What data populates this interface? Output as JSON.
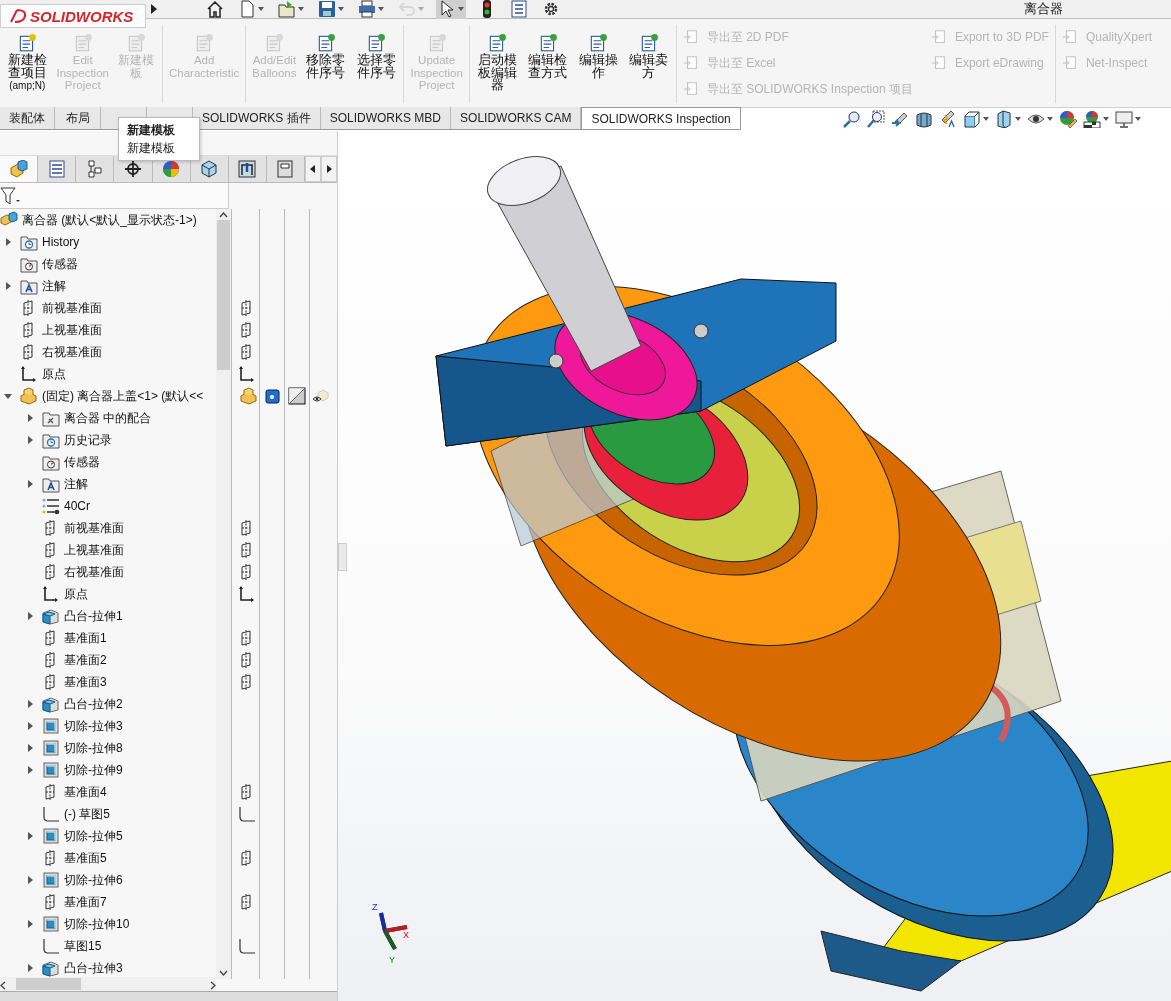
{
  "title_bar": {
    "logo": "SOLIDWORKS",
    "title": "离合器"
  },
  "quick_toolbar": [
    {
      "kind": "home",
      "disabled": false,
      "pressed": false
    },
    {
      "kind": "new",
      "disabled": false,
      "pressed": false
    },
    {
      "kind": "open",
      "disabled": false,
      "pressed": false
    },
    {
      "kind": "save",
      "disabled": false,
      "pressed": false
    },
    {
      "kind": "print",
      "disabled": false,
      "pressed": false
    },
    {
      "kind": "undo",
      "disabled": true,
      "pressed": false
    },
    {
      "kind": "select",
      "disabled": false,
      "pressed": true
    },
    {
      "kind": "rebuild",
      "disabled": false,
      "pressed": false
    },
    {
      "kind": "options-list",
      "disabled": false,
      "pressed": false
    },
    {
      "kind": "settings",
      "disabled": false,
      "pressed": false
    }
  ],
  "ribbon": {
    "groups": [
      {
        "buttons": [
          {
            "kind": "large",
            "label": "新建检查项目",
            "shortcut": "(amp;N)",
            "disabled": false
          },
          {
            "kind": "large",
            "label": "Edit Inspection Project",
            "disabled": true
          },
          {
            "kind": "large",
            "label": "新建模板",
            "disabled": true
          }
        ]
      },
      {
        "buttons": [
          {
            "kind": "large",
            "label": "Add Characteristic",
            "disabled": true
          }
        ]
      },
      {
        "buttons": [
          {
            "kind": "large",
            "label": "Add/Edit Balloons",
            "disabled": true
          },
          {
            "kind": "large",
            "label": "移除零件序号",
            "disabled": false
          },
          {
            "kind": "large",
            "label": "选择零件序号",
            "disabled": false
          }
        ]
      },
      {
        "buttons": [
          {
            "kind": "large",
            "label": "Update Inspection Project",
            "disabled": true
          }
        ]
      },
      {
        "buttons": [
          {
            "kind": "large",
            "label": "启动模板编辑器",
            "disabled": false
          },
          {
            "kind": "large",
            "label": "编辑检查方式",
            "disabled": false
          },
          {
            "kind": "large",
            "label": "编辑操作",
            "disabled": false
          },
          {
            "kind": "large",
            "label": "编辑卖方",
            "disabled": false
          }
        ]
      },
      {
        "buttons": [
          {
            "kind": "small",
            "label": "导出至 2D PDF",
            "disabled": true
          },
          {
            "kind": "small",
            "label": "导出至 Excel",
            "disabled": true
          },
          {
            "kind": "small",
            "label": "导出至 SOLIDWORKS Inspection 项目",
            "disabled": true
          },
          {
            "kind": "small",
            "label": "Export to 3D PDF",
            "disabled": true
          },
          {
            "kind": "small",
            "label": "Export eDrawing",
            "disabled": true
          }
        ]
      },
      {
        "buttons": [
          {
            "kind": "small",
            "label": "QualityXpert",
            "disabled": true
          },
          {
            "kind": "small",
            "label": "Net-Inspect",
            "disabled": true
          }
        ]
      }
    ]
  },
  "command_tabs": [
    {
      "label": "装配体",
      "selected": false
    },
    {
      "label": "布局",
      "selected": false
    },
    {
      "selected": false
    },
    {
      "selected": false
    },
    {
      "label": "SOLIDWORKS 插件",
      "selected": false
    },
    {
      "label": "SOLIDWORKS MBD",
      "selected": false
    },
    {
      "label": "SOLIDWORKS CAM",
      "selected": false
    },
    {
      "label": "SOLIDWORKS Inspection",
      "selected": true
    }
  ],
  "tooltip": {
    "title": "新建模板",
    "text": "新建模板"
  },
  "view_toolbar": [
    {
      "kind": "zoom-fit",
      "dropdown": false
    },
    {
      "kind": "zoom-area",
      "dropdown": false
    },
    {
      "kind": "previous-view",
      "dropdown": false
    },
    {
      "kind": "section-view",
      "dropdown": false
    },
    {
      "kind": "dynamic-annotation",
      "dropdown": false
    },
    {
      "kind": "view-orientation",
      "dropdown": true
    },
    {
      "kind": "display-style",
      "dropdown": true
    },
    {
      "kind": "hide-show",
      "dropdown": true
    },
    {
      "kind": "edit-appearance",
      "dropdown": false
    },
    {
      "kind": "scenes",
      "dropdown": true
    },
    {
      "kind": "display",
      "dropdown": true
    }
  ],
  "panel_tabs": [
    {
      "kind": "feature-tree",
      "selected": true
    },
    {
      "kind": "property",
      "selected": false
    },
    {
      "kind": "config",
      "selected": false
    },
    {
      "kind": "dimxpert",
      "selected": false
    },
    {
      "kind": "appearance",
      "selected": false
    },
    {
      "kind": "cam",
      "selected": false
    },
    {
      "kind": "inspection",
      "selected": false
    },
    {
      "kind": "partial",
      "selected": false
    }
  ],
  "tree": {
    "label": "离合器 (默认<默认_显示状态-1>)",
    "kind": "assembly",
    "children": [
      {
        "label": "History",
        "kind": "history",
        "expanded": false
      },
      {
        "label": "传感器",
        "kind": "sensor"
      },
      {
        "label": "注解",
        "kind": "annotation",
        "expanded": false
      },
      {
        "label": "前视基准面",
        "kind": "plane"
      },
      {
        "label": "上视基准面",
        "kind": "plane"
      },
      {
        "label": "右视基准面",
        "kind": "plane"
      },
      {
        "label": "原点",
        "kind": "origin"
      },
      {
        "label": "(固定) 离合器上盖<1> (默认<<",
        "kind": "component",
        "expanded": true,
        "children": [
          {
            "label": "离合器 中的配合",
            "kind": "mates",
            "expanded": false
          },
          {
            "label": "历史记录",
            "kind": "history",
            "expanded": false
          },
          {
            "label": "传感器",
            "kind": "sensor"
          },
          {
            "label": "注解",
            "kind": "annotation",
            "expanded": false
          },
          {
            "label": "40Cr",
            "kind": "material"
          },
          {
            "label": "前视基准面",
            "kind": "plane"
          },
          {
            "label": "上视基准面",
            "kind": "plane"
          },
          {
            "label": "右视基准面",
            "kind": "plane"
          },
          {
            "label": "原点",
            "kind": "origin"
          },
          {
            "label": "凸台-拉伸1",
            "kind": "boss",
            "expanded": false
          },
          {
            "label": "基准面1",
            "kind": "plane"
          },
          {
            "label": "基准面2",
            "kind": "plane"
          },
          {
            "label": "基准面3",
            "kind": "plane"
          },
          {
            "label": "凸台-拉伸2",
            "kind": "boss",
            "expanded": false
          },
          {
            "label": "切除-拉伸3",
            "kind": "cut",
            "expanded": false
          },
          {
            "label": "切除-拉伸8",
            "kind": "cut",
            "expanded": false
          },
          {
            "label": "切除-拉伸9",
            "kind": "cut",
            "expanded": false
          },
          {
            "label": "基准面4",
            "kind": "plane"
          },
          {
            "label": "(-) 草图5",
            "kind": "sketch"
          },
          {
            "label": "切除-拉伸5",
            "kind": "cut",
            "expanded": false
          },
          {
            "label": "基准面5",
            "kind": "plane"
          },
          {
            "label": "切除-拉伸6",
            "kind": "cut",
            "expanded": false
          },
          {
            "label": "基准面7",
            "kind": "plane"
          },
          {
            "label": "切除-拉伸10",
            "kind": "cut",
            "expanded": false
          },
          {
            "label": "草图15",
            "kind": "sketch"
          },
          {
            "label": "凸台-拉伸3",
            "kind": "boss",
            "expanded": false
          }
        ]
      }
    ]
  },
  "triad": {
    "x": "X",
    "y": "Y",
    "z": "Z"
  }
}
